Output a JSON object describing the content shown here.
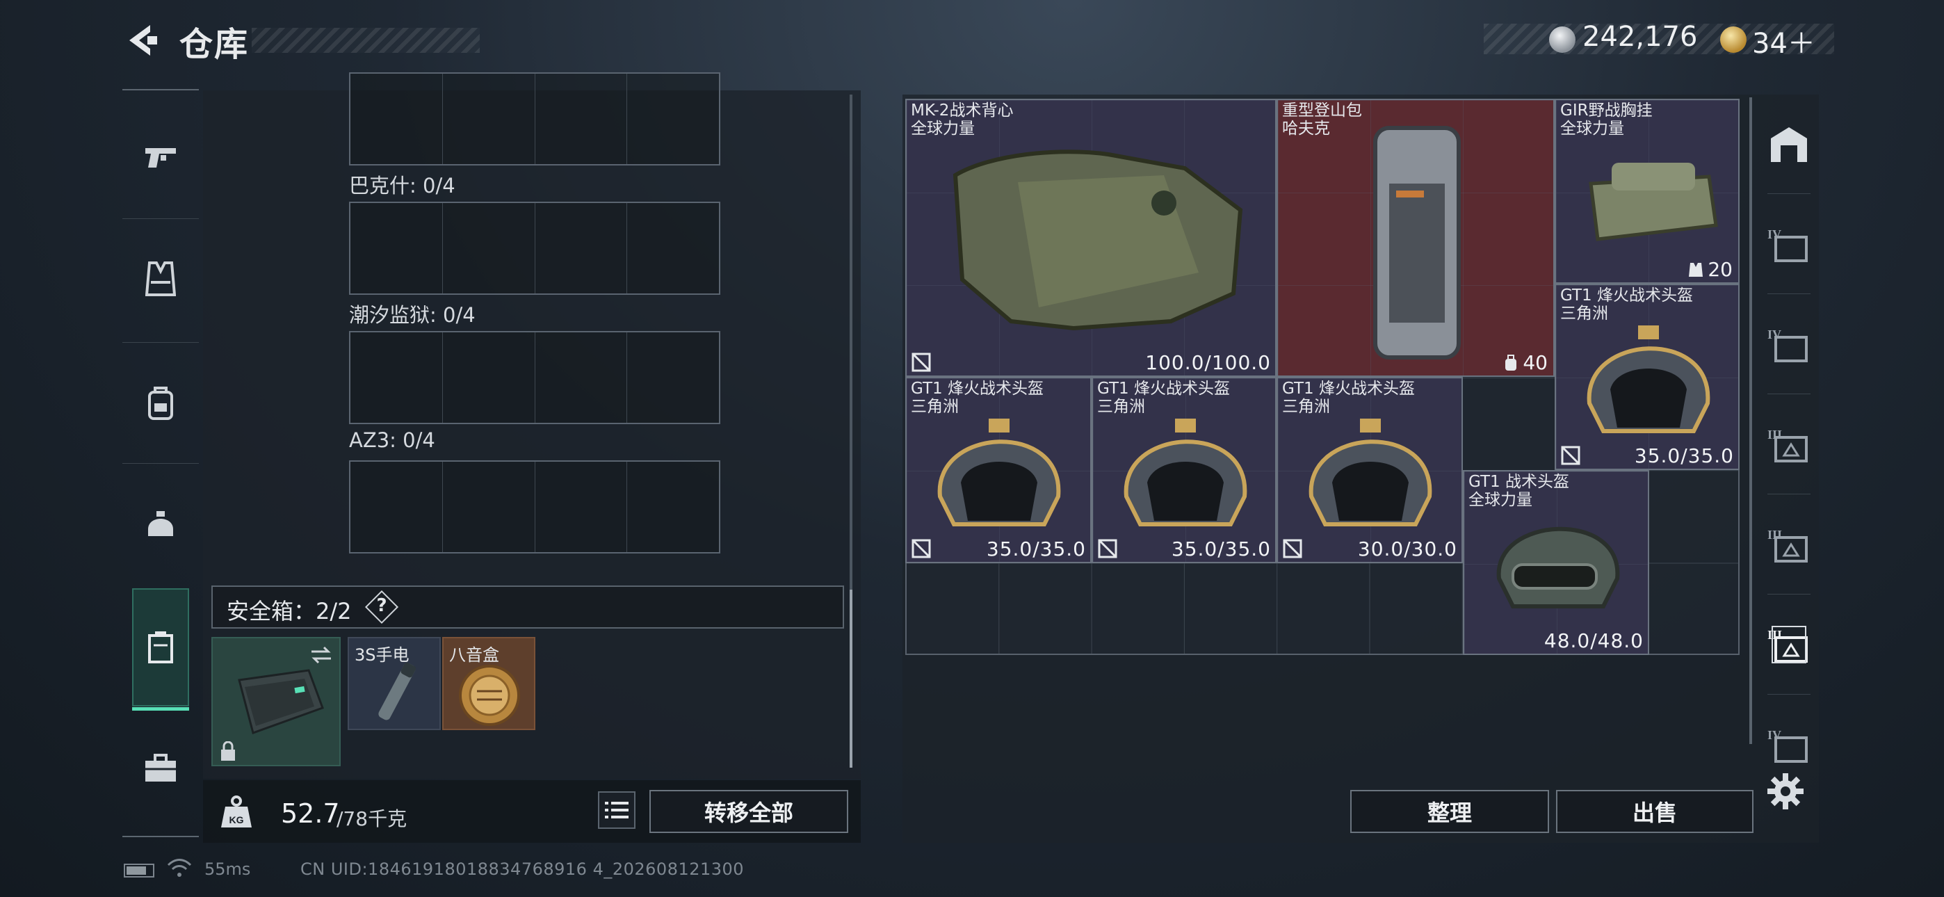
{
  "header": {
    "title": "仓库",
    "back_icon": "back-arrow-icon"
  },
  "currency": [
    {
      "icon": "silver-coin-icon",
      "value": "242,176"
    },
    {
      "icon": "gold-coin-icon",
      "value": "34＋"
    }
  ],
  "categories": [
    {
      "icon": "pistol-icon"
    },
    {
      "icon": "vest-icon"
    },
    {
      "icon": "backpack-icon"
    },
    {
      "icon": "helmet-icon"
    },
    {
      "icon": "container-icon",
      "active": true
    },
    {
      "icon": "briefcase-icon"
    }
  ],
  "backpack": {
    "sections": [
      {
        "label": "巴克什: 0/4"
      },
      {
        "label": "潮汐监狱: 0/4"
      },
      {
        "label": "AZ3: 0/4"
      }
    ],
    "safe_box": {
      "label": "安全箱：2/2",
      "help": "?"
    },
    "safe_items": [
      {
        "name": "3S手电"
      },
      {
        "name": "八音盒"
      }
    ],
    "weight": {
      "current": "52.7",
      "max": "/78千克"
    },
    "transfer_all": "转移全部"
  },
  "warehouse": {
    "items": [
      {
        "name": "MK-2战术背心",
        "map": "全球力量",
        "durability": "100.0/100.0"
      },
      {
        "name": "重型登山包",
        "map": "哈夫克",
        "badge": "40"
      },
      {
        "name": "GIR野战胸挂",
        "map": "全球力量",
        "badge": "20"
      },
      {
        "name": "GT1 烽火战术头盔",
        "map": "三角洲",
        "durability": "35.0/35.0"
      },
      {
        "name": "GT1 烽火战术头盔",
        "map": "三角洲",
        "durability": "35.0/35.0"
      },
      {
        "name": "GT1 烽火战术头盔",
        "map": "三角洲",
        "durability": "35.0/35.0"
      },
      {
        "name": "GT1 烽火战术头盔",
        "map": "三角洲",
        "durability": "30.0/30.0"
      },
      {
        "name": "GT1 战术头盔",
        "map": "全球力量",
        "durability": "48.0/48.0"
      }
    ],
    "side_tabs": [
      "IV",
      "IV",
      "III",
      "III",
      "III",
      "IV"
    ],
    "sort": "整理",
    "sell": "出售"
  },
  "status": {
    "ping": "55ms",
    "uid": "CN UID:18461918018834768916 4_202608121300"
  },
  "colors": {
    "accent": "#58e0b6",
    "purple_rarity": "#33324a",
    "red_rarity": "#5a2a30",
    "safe_green": "#2a4540"
  }
}
